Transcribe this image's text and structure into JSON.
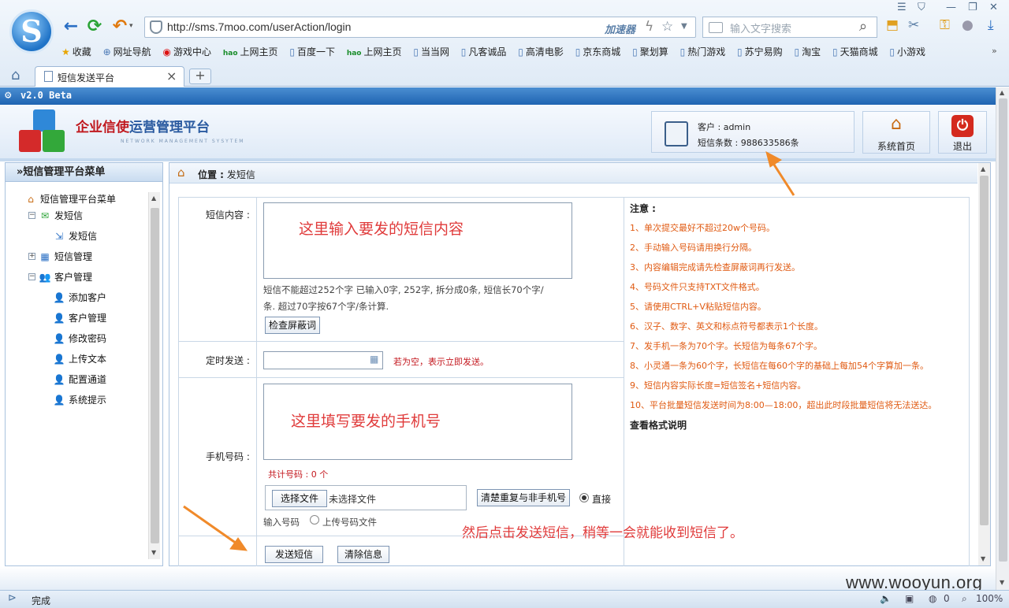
{
  "browser": {
    "url": "http://sms.7moo.com/userAction/login",
    "accelerator_label": "加速器",
    "search_placeholder": "输入文字搜索",
    "tab_title": "短信发送平台",
    "new_tab": "+",
    "bookmarks": [
      "收藏",
      "网址导航",
      "游戏中心",
      "上网主页",
      "百度一下",
      "上网主页",
      "当当网",
      "凡客诚品",
      "高清电影",
      "京东商城",
      "聚划算",
      "热门游戏",
      "苏宁易购",
      "淘宝",
      "天猫商城",
      "小游戏"
    ]
  },
  "app": {
    "version": "v2.0 Beta",
    "title_red": "企业信使",
    "title_blue": "运营管理平台",
    "subtitle": "NETWORK MANAGEMENT SYSYTEM",
    "user_line": "客户 : admin",
    "sms_count_line": "短信条数 : 988633586条",
    "home_button": "系统首页",
    "logout_button": "退出"
  },
  "sidebar": {
    "header": "»短信管理平台菜单",
    "root": "短信管理平台菜单",
    "items": [
      {
        "label": "发短信"
      },
      {
        "label": "发短信"
      },
      {
        "label": "短信管理"
      },
      {
        "label": "客户管理"
      },
      {
        "label": "添加客户"
      },
      {
        "label": "客户管理"
      },
      {
        "label": "修改密码"
      },
      {
        "label": "上传文本"
      },
      {
        "label": "配置通道"
      },
      {
        "label": "系统提示"
      }
    ]
  },
  "main": {
    "location_label": "位置 :",
    "location_value": "发短信",
    "content_label": "短信内容 :",
    "content_hint": "这里输入要发的短信内容",
    "limit_line1": "短信不能超过252个字  已输入0字,  252字,  拆分成0条, 短信长70个字/",
    "limit_line2": "条. 超过70字按67个字/条计算.",
    "check_words_button": "检查屏蔽词",
    "schedule_label": "定时发送 :",
    "schedule_hint": "若为空，表示立即发送。",
    "phone_label": "手机号码 :",
    "phone_hint": "这里填写要发的手机号",
    "count_line": "共计号码 : 0 个",
    "choose_file_button": "选择文件",
    "no_file": "未选择文件",
    "clear_dup_button": "清楚重复与非手机号",
    "direct_label": "直接",
    "input_numbers_label": "输入号码",
    "upload_file_label": "上传号码文件",
    "send_button": "发送短信",
    "clear_button": "清除信息",
    "instruction": "然后点击发送短信，稍等一会就能收到短信了。",
    "notes_title": "注意 :",
    "notes": [
      "1、单次提交最好不超过20w个号码。",
      "2、手动输入号码请用换行分隔。",
      "3、内容编辑完成请先检查屏蔽词再行发送。",
      "4、号码文件只支持TXT文件格式。",
      "5、请使用CTRL+V粘贴短信内容。",
      "6、汉子、数字、英文和标点符号都表示1个长度。",
      "7、发手机一条为70个字。长短信为每条67个字。",
      "8、小灵通一条为60个字，长短信在每60个字的基础上每加54个字算加一条。",
      "9、短信内容实际长度=短信签名+短信内容。",
      "10、平台批量短信发送时间为8:00—18:00，超出此时段批量短信将无法送达。"
    ],
    "format_link": "查看格式说明"
  },
  "status": {
    "done": "完成",
    "count": "0",
    "zoom": "100%"
  },
  "watermark": "www.wooyun.org",
  "colors": {
    "accent_blue": "#1f64b2",
    "note_orange": "#e05a12",
    "annotation_red": "#e03b3b",
    "arrow_orange": "#f08a2a"
  }
}
